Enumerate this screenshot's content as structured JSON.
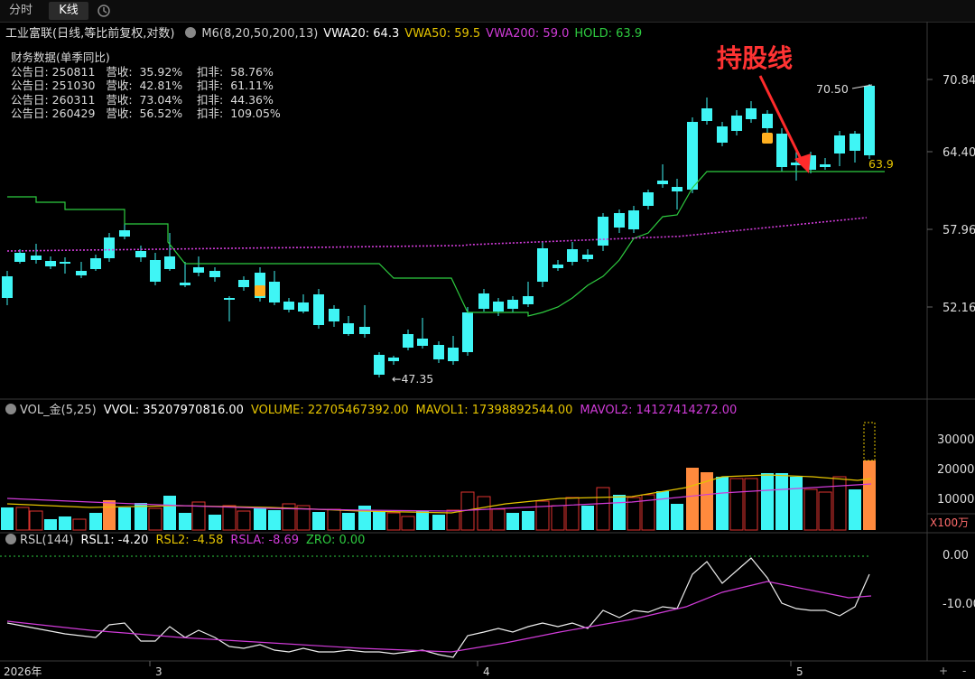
{
  "tabs": [
    {
      "label": "分时",
      "active": false
    },
    {
      "label": "K线",
      "active": true
    }
  ],
  "main": {
    "stock_title": "工业富联(日线,等比前复权,对数)",
    "indicators": [
      {
        "text": "M6(8,20,50,200,13)",
        "color": "#cccccc"
      },
      {
        "text": "VWA20: 64.3",
        "color": "#ffffff"
      },
      {
        "text": "VWA50: 59.5",
        "color": "#e5c400"
      },
      {
        "text": "VWA200: 59.0",
        "color": "#d03bd8"
      },
      {
        "text": "HOLD: 63.9",
        "color": "#2ecc40"
      }
    ],
    "financial_header": "财务数据(单季同比)",
    "financial_rows": [
      "公告日: 250811   营收:  35.92%    扣非:  58.76%",
      "公告日: 251030   营收:  42.81%    扣非:  61.11%",
      "公告日: 260311   营收:  73.04%    扣非:  44.36%",
      "公告日: 260429   营收:  56.52%    扣非:  109.05%"
    ],
    "annotation": "持股线",
    "price_axis": [
      "70.84",
      "64.40",
      "57.96",
      "52.16"
    ],
    "high_label": "70.50",
    "low_label": "47.35",
    "hold_label": "63.9"
  },
  "volume": {
    "indicators": [
      {
        "text": "VOL_金(5,25)",
        "color": "#cccccc"
      },
      {
        "text": "VVOL: 35207970816.00",
        "color": "#ffffff"
      },
      {
        "text": "VOLUME: 22705467392.00",
        "color": "#e5c400"
      },
      {
        "text": "MAVOL1: 17398892544.00",
        "color": "#e5c400"
      },
      {
        "text": "MAVOL2: 14127414272.00",
        "color": "#d03bd8"
      }
    ],
    "axis": [
      "30000",
      "20000",
      "10000"
    ],
    "unit": "X100万"
  },
  "rsl": {
    "indicators": [
      {
        "text": "RSL(144)",
        "color": "#cccccc"
      },
      {
        "text": "RSL1: -4.20",
        "color": "#ffffff"
      },
      {
        "text": "RSL2: -4.58",
        "color": "#e5c400"
      },
      {
        "text": "RSLA: -8.69",
        "color": "#d03bd8"
      },
      {
        "text": "ZRO: 0.00",
        "color": "#2ecc40"
      }
    ],
    "axis": [
      "0.00",
      "-10.00"
    ]
  },
  "date_axis": [
    "2026年",
    "3",
    "4",
    "5"
  ],
  "colors": {
    "up": "#e0332f",
    "down": "#3ff5f5",
    "volume_orange": "#ff8a3d",
    "hold": "#2ecc40",
    "vwa200": "#d03bd8",
    "vwa50": "#e5c400"
  }
}
